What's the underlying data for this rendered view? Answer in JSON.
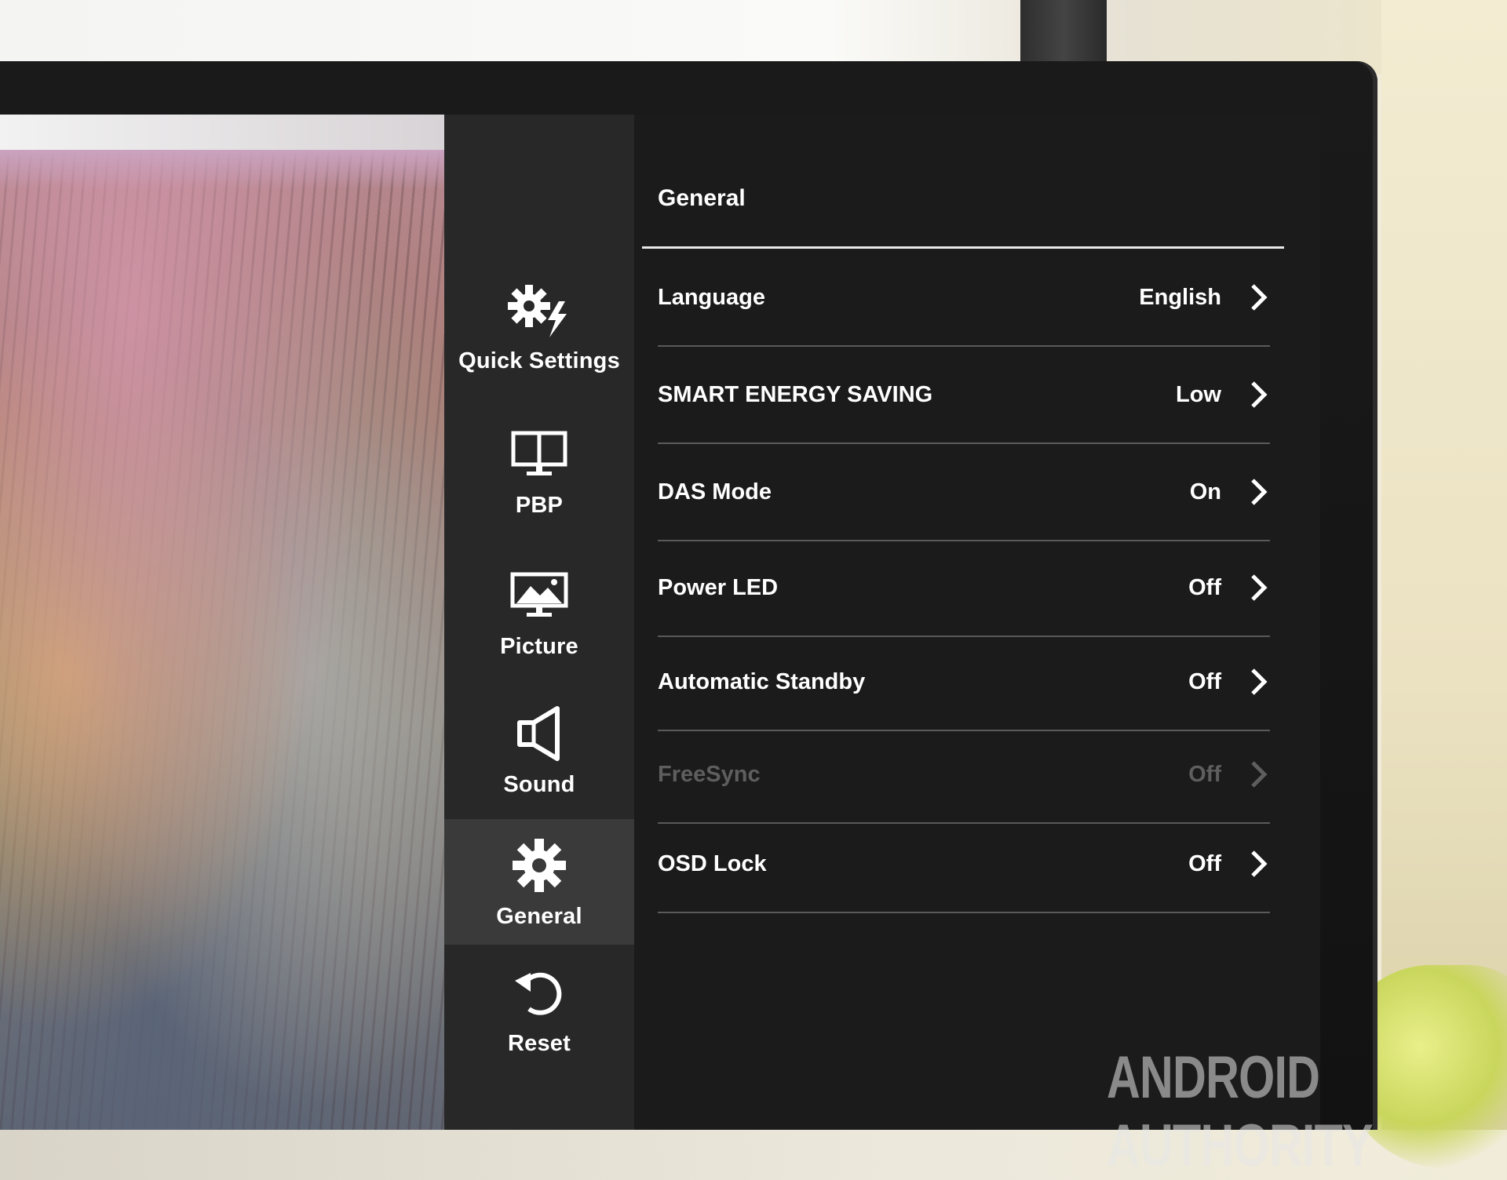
{
  "osd": {
    "sidebar": {
      "items": [
        {
          "label": "Quick Settings",
          "icon": "quick-settings-icon"
        },
        {
          "label": "PBP",
          "icon": "pbp-icon"
        },
        {
          "label": "Picture",
          "icon": "picture-icon"
        },
        {
          "label": "Sound",
          "icon": "sound-icon"
        },
        {
          "label": "General",
          "icon": "gear-icon",
          "active": true
        },
        {
          "label": "Reset",
          "icon": "reset-icon"
        }
      ]
    },
    "main": {
      "title": "General",
      "rows": [
        {
          "label": "Language",
          "value": "English"
        },
        {
          "label": "SMART ENERGY SAVING",
          "value": "Low"
        },
        {
          "label": "DAS Mode",
          "value": "On"
        },
        {
          "label": "Power LED",
          "value": "Off"
        },
        {
          "label": "Automatic Standby",
          "value": "Off"
        },
        {
          "label": "FreeSync",
          "value": "Off",
          "disabled": true
        },
        {
          "label": "OSD Lock",
          "value": "Off"
        }
      ]
    }
  },
  "watermark": "ANDROID AUTHORITY",
  "colors": {
    "sidebar_bg": "#282828",
    "panel_bg": "#1b1b1b",
    "active_bg": "#3a3a3a",
    "text": "#ffffff",
    "disabled_text": "#5e5e5e"
  }
}
